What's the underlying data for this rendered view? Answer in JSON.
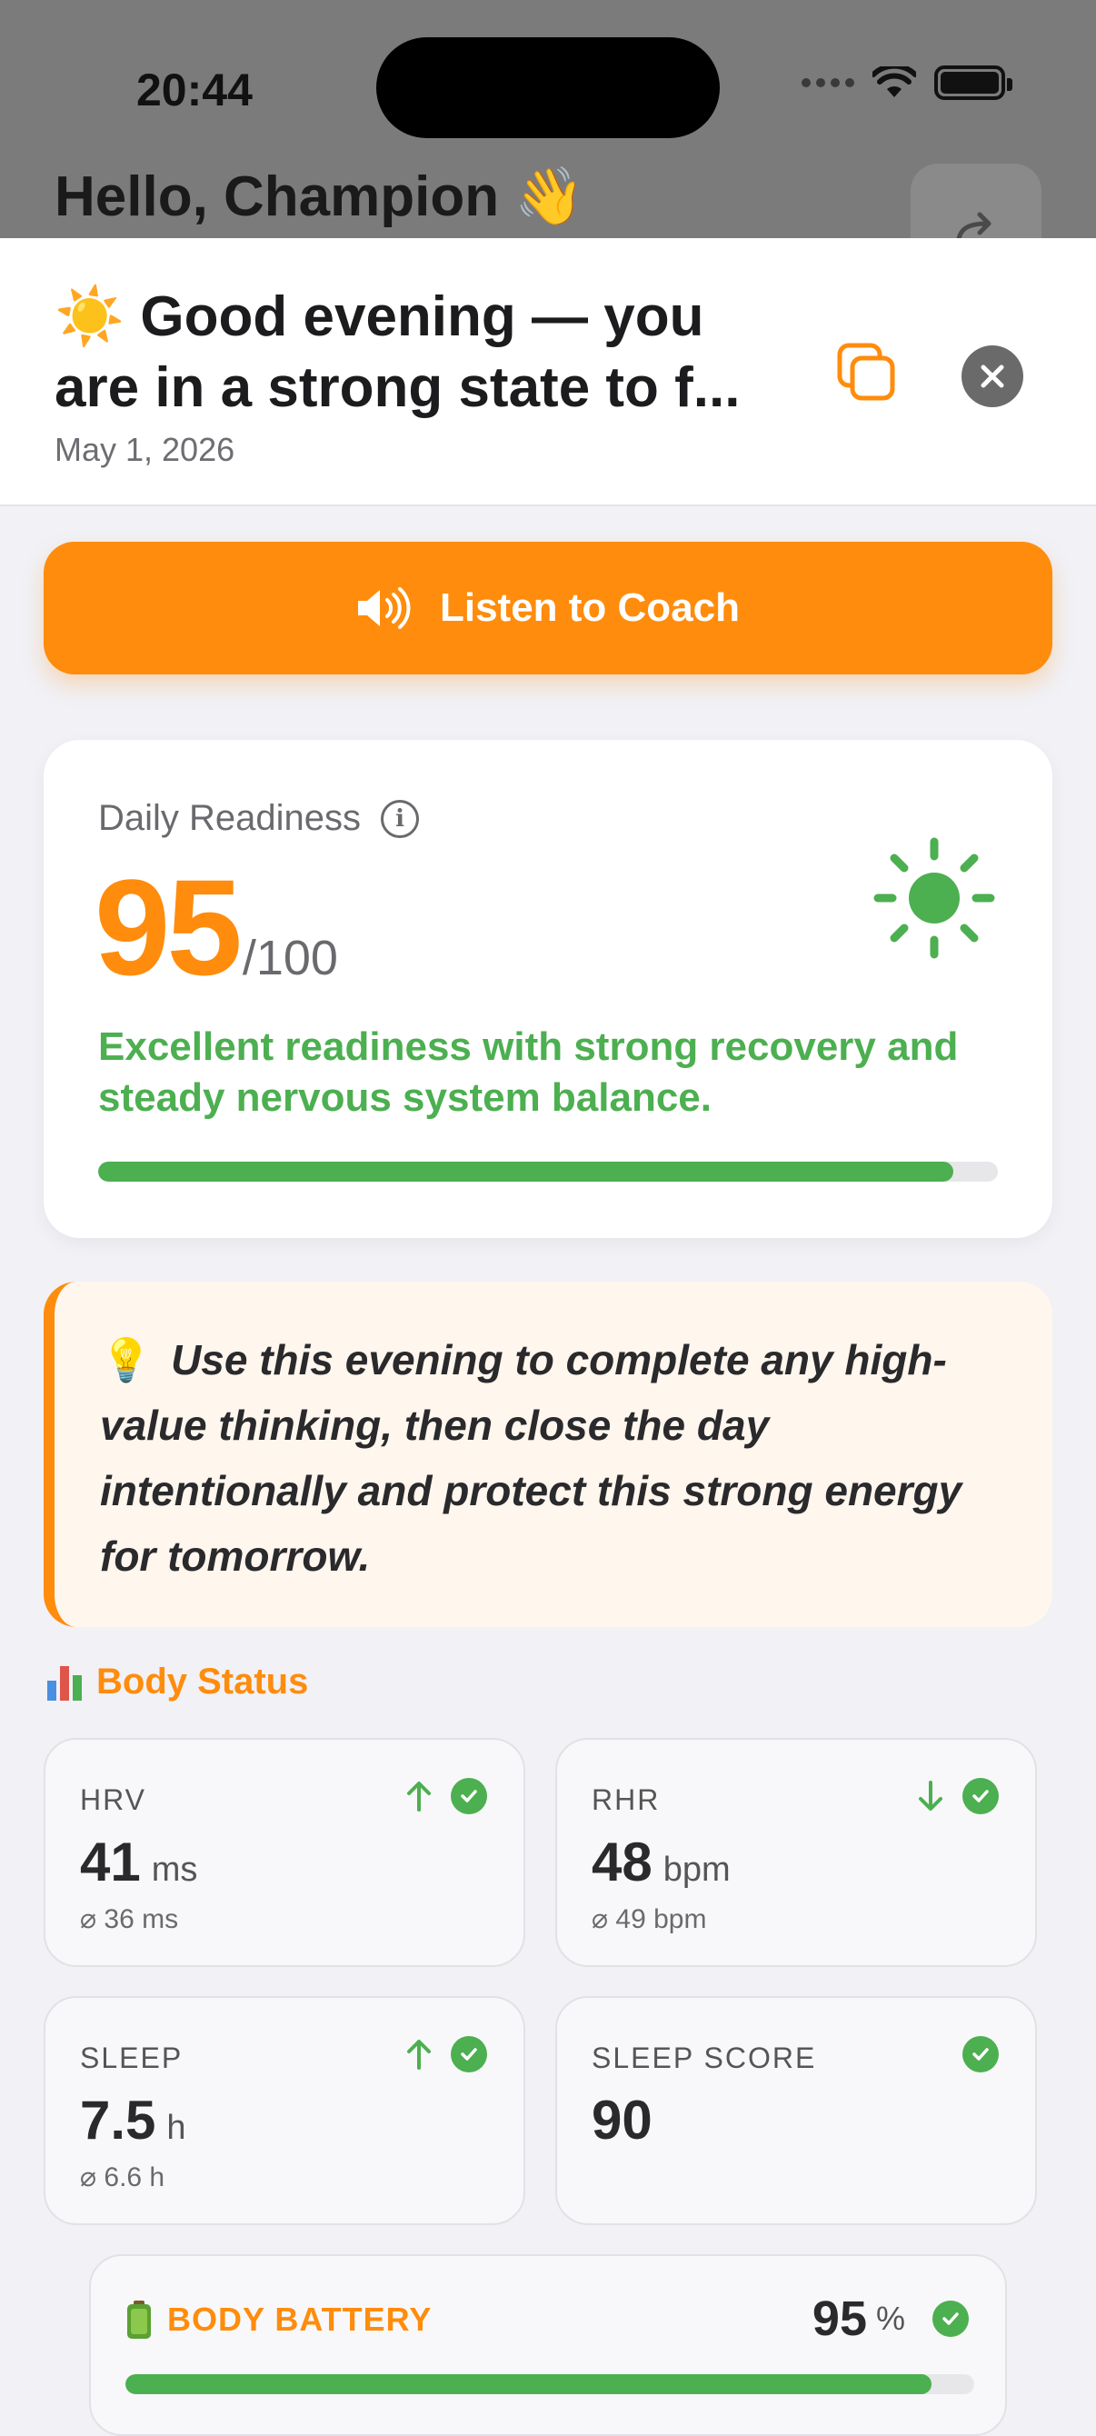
{
  "status_bar": {
    "time": "20:44"
  },
  "background": {
    "greeting": "Hello, Champion 👋"
  },
  "sheet": {
    "title": "☀️ Good evening — you are in a strong state to f...",
    "date": "May 1, 2026"
  },
  "listen_button": {
    "label": "Listen to Coach"
  },
  "readiness": {
    "label": "Daily Readiness",
    "score": "95",
    "max": "/100",
    "description": "Excellent readiness with strong recovery and steady nervous system balance.",
    "progress": 0.95
  },
  "tip": {
    "icon": "💡",
    "text": "Use this evening to complete any high-value thinking, then close the day intentionally and protect this strong energy for tomorrow."
  },
  "body_status": {
    "title": "Body Status",
    "metrics": [
      {
        "label": "HRV",
        "value": "41",
        "unit": "ms",
        "avg": "⌀ 36 ms",
        "trend": "up"
      },
      {
        "label": "RHR",
        "value": "48",
        "unit": "bpm",
        "avg": "⌀ 49 bpm",
        "trend": "down"
      },
      {
        "label": "SLEEP",
        "value": "7.5",
        "unit": "h",
        "avg": "⌀ 6.6 h",
        "trend": "up"
      },
      {
        "label": "SLEEP SCORE",
        "value": "90",
        "unit": "",
        "avg": "",
        "trend": ""
      }
    ]
  },
  "body_battery": {
    "label": "BODY BATTERY",
    "value": "95",
    "unit": "%",
    "progress": 0.95
  },
  "colors": {
    "accent": "#ff8c0c",
    "good": "#4caf50"
  }
}
